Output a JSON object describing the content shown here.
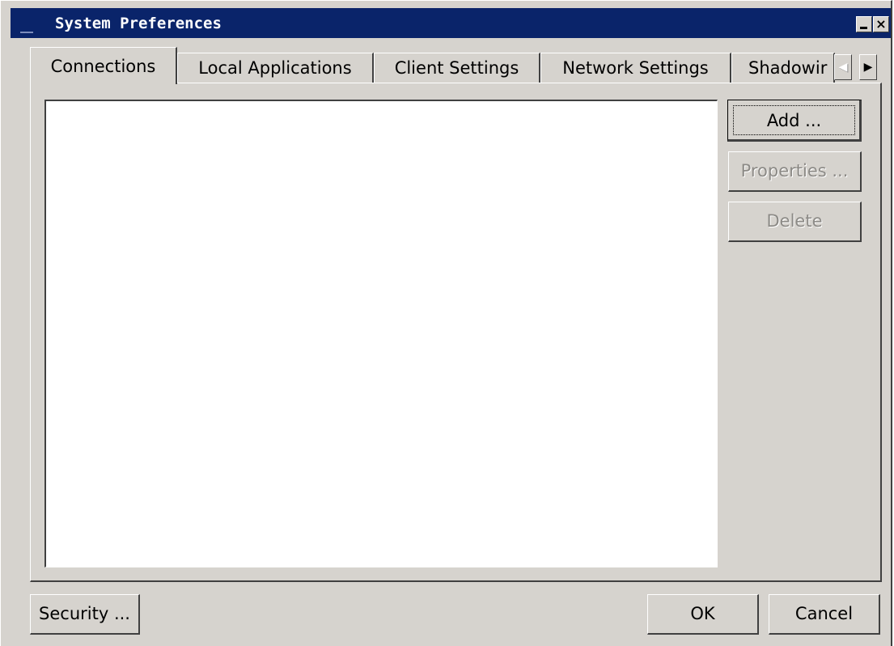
{
  "window": {
    "title": "System Preferences",
    "minimize_label": "_",
    "close_label": "×"
  },
  "tabs": [
    {
      "label": "Connections",
      "active": true
    },
    {
      "label": "Local Applications",
      "active": false
    },
    {
      "label": "Client Settings",
      "active": false
    },
    {
      "label": "Network Settings",
      "active": false
    },
    {
      "label": "Shadowir",
      "active": false
    }
  ],
  "tab_scroll": {
    "left_icon": "triangle-left",
    "left_glyph": "◀",
    "right_icon": "triangle-right",
    "right_glyph": "▶"
  },
  "connections": {
    "items": [],
    "buttons": {
      "add": "Add ...",
      "properties": "Properties ...",
      "delete": "Delete"
    }
  },
  "footer": {
    "security": "Security ...",
    "ok": "OK",
    "cancel": "Cancel"
  },
  "colors": {
    "titlebar": "#0a246a",
    "face": "#d6d3ce",
    "disabled_text": "#8c8a86"
  }
}
